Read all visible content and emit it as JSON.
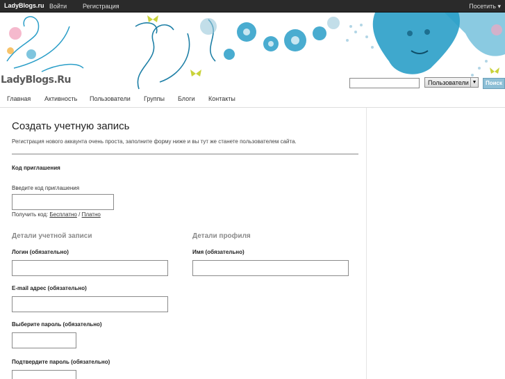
{
  "adminbar": {
    "brand": "LadyBlogs.ru",
    "login": "Войти",
    "register": "Регистрация",
    "visit": "Посетить"
  },
  "logo": "LadyBlogs.Ru",
  "search": {
    "select_value": "Пользователи",
    "button": "Поиск"
  },
  "nav": [
    "Главная",
    "Активность",
    "Пользователи",
    "Группы",
    "Блоги",
    "Контакты"
  ],
  "page": {
    "title": "Создать учетную запись",
    "intro": "Регистрация нового аккаунта очень проста, заполните форму ниже и вы тут же станете пользователем сайта.",
    "invite_heading": "Код приглашения",
    "invite_label": "Введите код приглашения",
    "get_code": "Получить код:",
    "free": "Бесплатно",
    "sep": "/",
    "paid": "Платно",
    "account_section": "Детали учетной записи",
    "profile_section": "Детали профиля",
    "login_label": "Логин (обязательно)",
    "email_label": "E-mail адрес (обязательно)",
    "password_label": "Выберите пароль (обязательно)",
    "confirm_label": "Подтвердите пароль (обязательно)",
    "name_label": "Имя (обязательно)"
  },
  "colors": {
    "adminbar": "#2a2a2a",
    "accent": "#2a9ec8",
    "search_button": "#8dbfd6"
  }
}
